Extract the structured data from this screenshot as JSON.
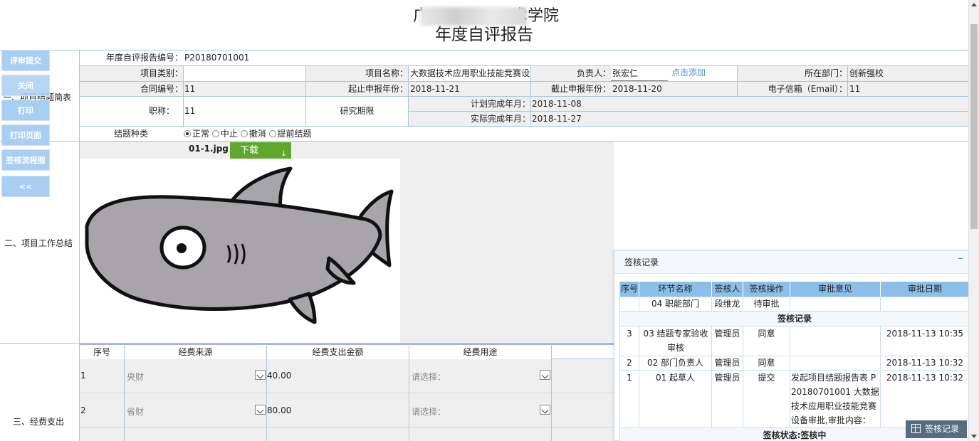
{
  "header": {
    "line1_visible": "广",
    "line1_end": "术学院",
    "line2": "年度自评报告"
  },
  "sidebar": [
    "评审提交",
    "关闭",
    "打印",
    "打印页面",
    "签核流程图",
    "<<"
  ],
  "sections": {
    "s1": "一、项目结题简表",
    "s2": "二、项目工作总结",
    "s3": "三、经费支出"
  },
  "form": {
    "report_no_label": "年度自评报告编号：",
    "report_no": "P20180701001",
    "category_label": "项目类别：",
    "category": "",
    "name_label": "项目名称：",
    "name": "大数据技术应用职业技能竞赛设",
    "owner_label": "负责人：",
    "owner": "张宏仁",
    "add_link": "点击添加",
    "dept_label": "所在部门：",
    "dept": "创新强校",
    "contract_label": "合同编号：",
    "contract": "11",
    "start_label": "起止申报年份：",
    "start": "2018-11-21",
    "end_label": "截止申报年份：",
    "end": "2018-11-20",
    "email_label": "电子信箱（Email）：",
    "email": "11",
    "title_label": "职称：",
    "title": "11",
    "period_label": "研究期限",
    "plan_label": "计划完成年月：",
    "plan": "2018-11-08",
    "actual_label": "实际完成年月：",
    "actual": "2018-11-27",
    "type_label": "结题种类",
    "types": [
      "正常",
      "中止",
      "撤消",
      "提前结题"
    ],
    "type_selected": "正常"
  },
  "attachment": {
    "file": "01-1.jpg",
    "download": "下载"
  },
  "fees": {
    "headers": [
      "序号",
      "经费来源",
      "经费支出金额",
      "经费用途"
    ],
    "rows": [
      {
        "no": "1",
        "source": "央财",
        "amount": "40.00",
        "usage": "请选择："
      },
      {
        "no": "2",
        "source": "省财",
        "amount": "80.00",
        "usage": "请选择："
      }
    ]
  },
  "review_panel": {
    "title": "签核记录",
    "headers": [
      "序号",
      "环节名称",
      "签核人",
      "签核操作",
      "审批意见",
      "审批日期"
    ],
    "pending": {
      "step": "04 职能部门",
      "person": "段维龙",
      "action": "待审批"
    },
    "records_title": "签核记录",
    "records": [
      {
        "no": "3",
        "step": "03 结题专家验收审核",
        "person": "管理员",
        "action": "同意",
        "opinion": "",
        "date": "2018-11-13 10:35"
      },
      {
        "no": "2",
        "step": "02 部门负责人",
        "person": "管理员",
        "action": "同意",
        "opinion": "",
        "date": "2018-11-13 10:32"
      },
      {
        "no": "1",
        "step": "01 起草人",
        "person": "管理员",
        "action": "提交",
        "opinion": "发起项目结题报告表 P20180701001 大数据技术应用职业技能竞赛设备审批,审批内容：",
        "date": "2018-11-13 10:32"
      }
    ],
    "status": "签核状态:签核中"
  },
  "record_button": "签核记录"
}
